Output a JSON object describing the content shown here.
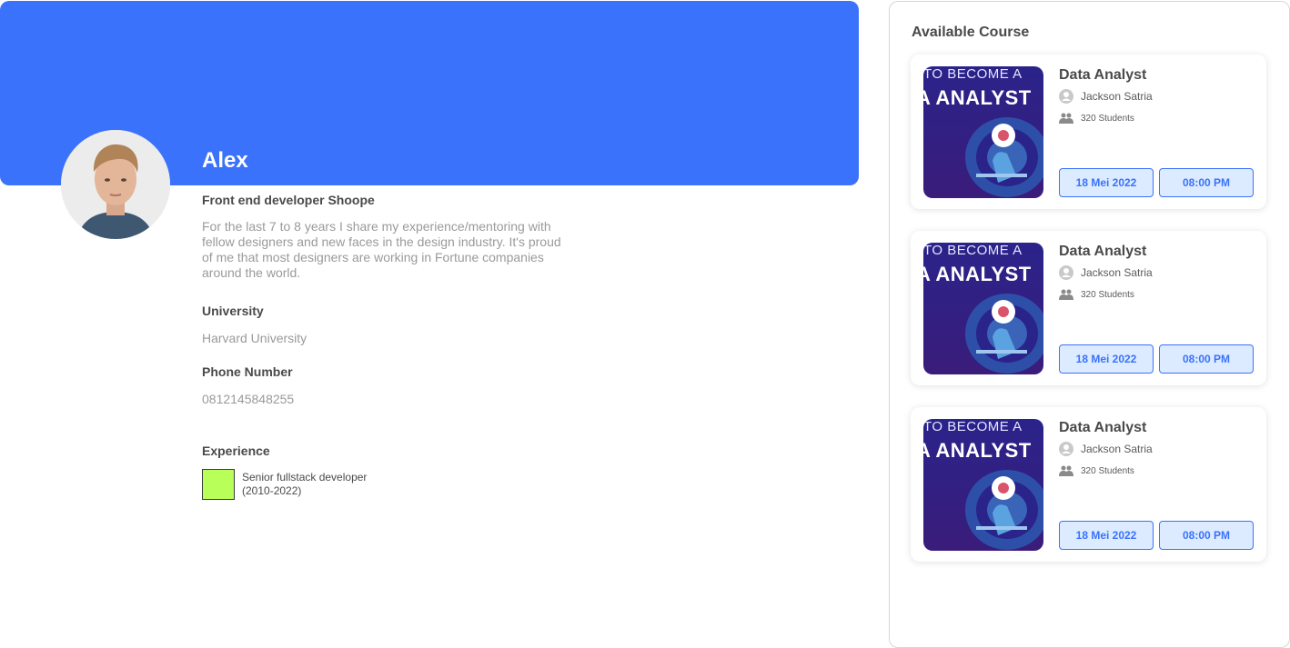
{
  "profile": {
    "name": "Alex",
    "role": "Front end developer Shoope",
    "bio": "For the last 7 to 8 years I share my experience/mentoring with fellow designers and new faces in the design industry. It's proud of me that most designers are working in Fortune companies around the world.",
    "university_label": "University",
    "university_value": "Harvard University",
    "phone_label": "Phone Number",
    "phone_value": "0812145848255",
    "experience_label": "Experience",
    "experience_item_line1": "Senior fullstack developer",
    "experience_item_line2": "(2010-2022)",
    "banner_color": "#3a72fc",
    "experience_swatch_color": "#b8ff5a"
  },
  "courses_panel": {
    "title": "Available Course",
    "cards": [
      {
        "thumb_top": "TO BECOME A",
        "thumb_big": "A ANALYST",
        "title": "Data Analyst",
        "mentor": "Jackson Satria",
        "students": "320 Students",
        "date": "18 Mei 2022",
        "time": "08:00 PM"
      },
      {
        "thumb_top": "TO BECOME A",
        "thumb_big": "A ANALYST",
        "title": "Data Analyst",
        "mentor": "Jackson Satria",
        "students": "320 Students",
        "date": "18 Mei 2022",
        "time": "08:00 PM"
      },
      {
        "thumb_top": "TO BECOME A",
        "thumb_big": "A ANALYST",
        "title": "Data Analyst",
        "mentor": "Jackson Satria",
        "students": "320 Students",
        "date": "18 Mei 2022",
        "time": "08:00 PM"
      }
    ]
  },
  "icons": {
    "mentor": "user-circle-icon",
    "students": "users-icon"
  }
}
